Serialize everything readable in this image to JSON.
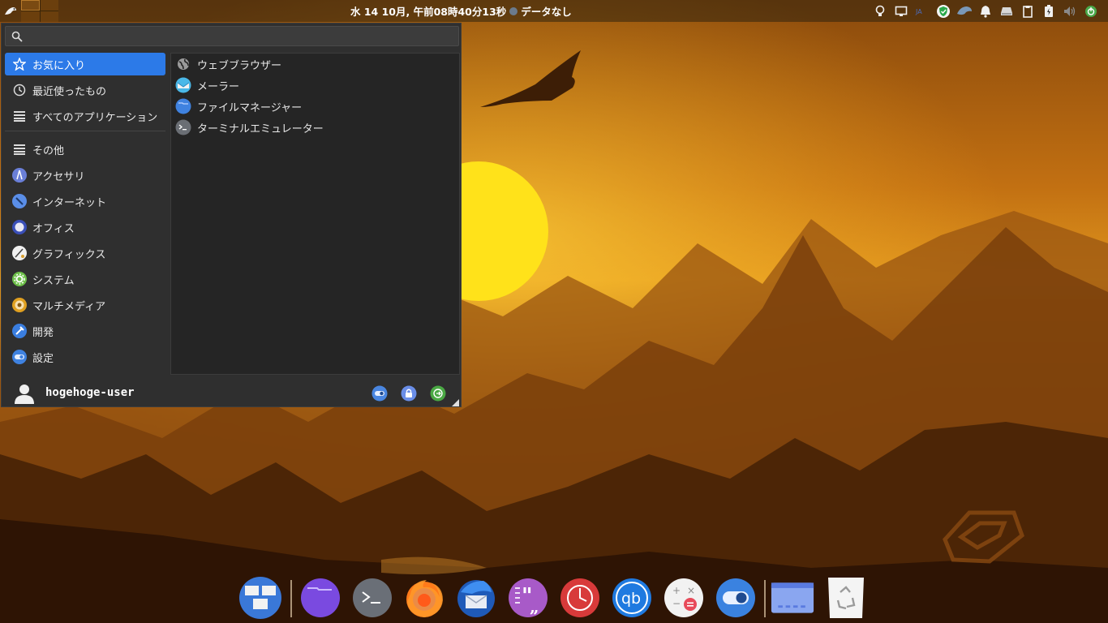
{
  "panel": {
    "clock": "水 14 10月, 午前08時40分13秒",
    "weather": "データなし"
  },
  "search": {
    "query": "",
    "placeholder": ""
  },
  "menu": {
    "categories": [
      {
        "label": "お気に入り",
        "icon": "star-icon",
        "selected": true
      },
      {
        "label": "最近使ったもの",
        "icon": "clock-icon"
      },
      {
        "label": "すべてのアプリケーション",
        "icon": "list-icon"
      },
      {
        "label": "その他",
        "icon": "list-icon"
      },
      {
        "label": "アクセサリ",
        "icon": "accessories-icon"
      },
      {
        "label": "インターネット",
        "icon": "internet-icon"
      },
      {
        "label": "オフィス",
        "icon": "office-icon"
      },
      {
        "label": "グラフィックス",
        "icon": "graphics-icon"
      },
      {
        "label": "システム",
        "icon": "system-icon"
      },
      {
        "label": "マルチメディア",
        "icon": "multimedia-icon"
      },
      {
        "label": "開発",
        "icon": "development-icon"
      },
      {
        "label": "設定",
        "icon": "settings-icon"
      }
    ],
    "apps": [
      {
        "label": "ウェブブラウザー",
        "icon": "web-browser-icon"
      },
      {
        "label": "メーラー",
        "icon": "mail-icon"
      },
      {
        "label": "ファイルマネージャー",
        "icon": "file-manager-icon"
      },
      {
        "label": "ターミナルエミュレーター",
        "icon": "terminal-icon"
      }
    ],
    "username": "hogehoge-user"
  },
  "colors": {
    "accent": "#2c7ae8",
    "menu_bg": "#2f2f2f",
    "apps_bg": "#252525"
  },
  "dock": [
    "workspaces-icon",
    "file-manager-icon",
    "terminal-icon",
    "firefox-icon",
    "thunderbird-icon",
    "quotes-icon",
    "timeshift-icon",
    "qbittorrent-icon",
    "calculator-icon",
    "settings-toggle-icon",
    "window-icon",
    "trash-icon"
  ]
}
